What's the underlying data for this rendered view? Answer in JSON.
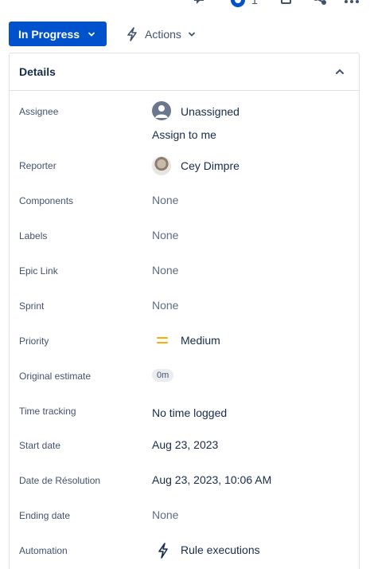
{
  "topbar": {
    "watch_count": "1"
  },
  "status_button": {
    "label": "In Progress"
  },
  "actions_button": {
    "label": "Actions"
  },
  "panel": {
    "title": "Details"
  },
  "fields": {
    "assignee": {
      "label": "Assignee",
      "value": "Unassigned",
      "assign_link": "Assign to me"
    },
    "reporter": {
      "label": "Reporter",
      "value": "Cey Dimpre"
    },
    "components": {
      "label": "Components",
      "value": "None"
    },
    "labels": {
      "label": "Labels",
      "value": "None"
    },
    "epic_link": {
      "label": "Epic Link",
      "value": "None"
    },
    "sprint": {
      "label": "Sprint",
      "value": "None"
    },
    "priority": {
      "label": "Priority",
      "value": "Medium",
      "color": "#ffab00"
    },
    "original_estimate": {
      "label": "Original estimate",
      "value": "0m"
    },
    "time_tracking": {
      "label": "Time tracking",
      "value": "No time logged"
    },
    "start_date": {
      "label": "Start date",
      "value": "Aug 23, 2023"
    },
    "resolution_date": {
      "label": "Date de Résolution",
      "value": "Aug 23, 2023, 10:06 AM"
    },
    "ending_date": {
      "label": "Ending date",
      "value": "None"
    },
    "automation": {
      "label": "Automation",
      "value": "Rule executions"
    }
  },
  "icons": {
    "topbar": [
      "feedback-icon",
      "watch-icon",
      "copy-icon",
      "share-icon",
      "more-icon"
    ],
    "status": "chevron-down-icon",
    "actions": "lightning-icon",
    "panel": "chevron-up-icon"
  },
  "colors": {
    "primary": "#0052cc",
    "text": "#172b4d",
    "muted": "#5e6c84"
  }
}
